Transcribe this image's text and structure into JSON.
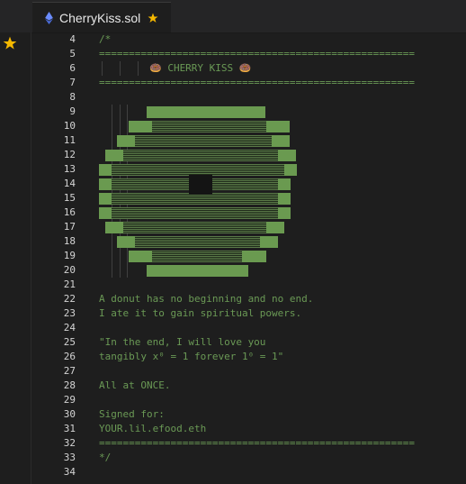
{
  "tab": {
    "title": "CherryKiss.sol",
    "file_icon": "ethereum-icon",
    "star_icon": "star-icon",
    "star_color": "#f5b800"
  },
  "activity_bar": {
    "favorite_icon": "star-icon"
  },
  "editor": {
    "line_numbers": [
      "4",
      "5",
      "6",
      "7",
      "8",
      "9",
      "10",
      "11",
      "12",
      "13",
      "14",
      "15",
      "16",
      "17",
      "18",
      "19",
      "20",
      "21",
      "22",
      "23",
      "24",
      "25",
      "26",
      "27",
      "28",
      "29",
      "30",
      "31",
      "32",
      "33",
      "34"
    ],
    "lines": {
      "l4": "/*",
      "l5": "=====================================================",
      "l6": "🍩 CHERRY KISS 🍩",
      "l7": "=====================================================",
      "l22": "A donut has no beginning and no end.",
      "l23": "I ate it to gain spiritual powers.",
      "l25": "\"In the end, I will love you",
      "l26": "tangibly x⁰ = 1 forever 1⁰ = 1\"",
      "l28": "All at ONCE.",
      "l30": "Signed for:",
      "l31": "YOUR.lil.efood.eth",
      "l32": "=====================================================",
      "l33": "*/"
    },
    "comment_color": "#6a9955",
    "art_color": "#6a9a50"
  }
}
